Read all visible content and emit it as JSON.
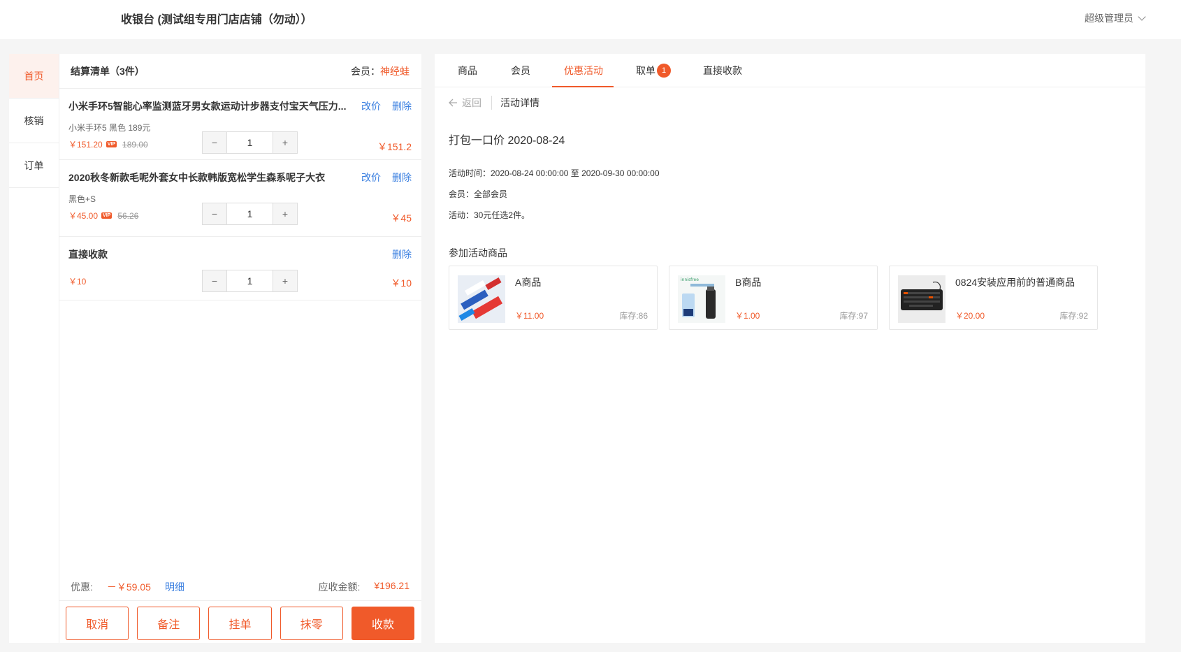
{
  "header": {
    "title": "收银台 (测试组专用门店店铺（勿动））",
    "user": "超级管理员"
  },
  "sidenav": {
    "items": [
      {
        "label": "首页",
        "active": true
      },
      {
        "label": "核销",
        "active": false
      },
      {
        "label": "订单",
        "active": false
      }
    ]
  },
  "cart": {
    "heading": "结算清单（3件）",
    "member_label": "会员：",
    "member_name": "神经蛙",
    "items": [
      {
        "name": "小米手环5智能心率监测蓝牙男女款运动计步器支付宝天气压力...",
        "spec": "小米手环5 黑色 189元",
        "price": "￥151.20",
        "vip": "VIP",
        "original": "189.00",
        "qty": "1",
        "total": "￥151.2",
        "edit": "改价",
        "delete": "删除"
      },
      {
        "name": "2020秋冬新款毛呢外套女中长款韩版宽松学生森系呢子大衣",
        "spec": "黑色+S",
        "price": "￥45.00",
        "vip": "VIP",
        "original": "56.26",
        "qty": "1",
        "total": "￥45",
        "edit": "改价",
        "delete": "删除"
      },
      {
        "name": "直接收款",
        "price": "￥10",
        "qty": "1",
        "total": "￥10",
        "delete": "删除"
      }
    ],
    "minus": "−",
    "plus": "+",
    "discount_label": "优惠:",
    "discount_value": "－￥59.05",
    "detail_link": "明细",
    "due_label": "应收金额:",
    "due_value": "¥196.21",
    "buttons": {
      "cancel": "取消",
      "note": "备注",
      "hold": "挂单",
      "round": "抹零",
      "pay": "收款"
    }
  },
  "panel": {
    "tabs": [
      {
        "label": "商品"
      },
      {
        "label": "会员"
      },
      {
        "label": "优惠活动",
        "active": true
      },
      {
        "label": "取单",
        "badge": "1"
      },
      {
        "label": "直接收款"
      }
    ],
    "back_label": "返回",
    "crumb": "活动详情",
    "activity_title": "打包一口价 2020-08-24",
    "info": {
      "time": "活动时间：2020-08-24 00:00:00 至 2020-09-30 00:00:00",
      "member": "会员：全部会员",
      "rule": "活动：30元任选2件。"
    },
    "section_title": "参加活动商品",
    "products": [
      {
        "name": "A商品",
        "price": "￥11.00",
        "stock": "库存:86"
      },
      {
        "name": "B商品",
        "price": "￥1.00",
        "stock": "库存:97",
        "thumb_text": "innisfree"
      },
      {
        "name": "0824安装应用前的普通商品",
        "price": "￥20.00",
        "stock": "库存:92"
      }
    ]
  },
  "colors": {
    "accent": "#f05a2a",
    "link": "#3a7fe0"
  }
}
